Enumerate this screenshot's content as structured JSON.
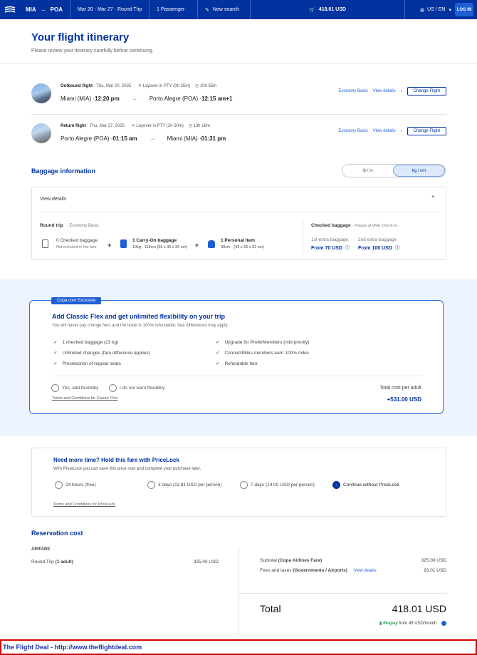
{
  "header": {
    "origin": "MIA",
    "destination": "POA",
    "dates": "Mar 20 - Mar 27 · Round Trip",
    "passengers": "1 Passenger",
    "new_search": "New search",
    "cart_total": "418.01 USD",
    "locale": "US / EN",
    "login": "LOG IN"
  },
  "page": {
    "title": "Your flight itinerary",
    "subtitle": "Please review your itinerary carefully before continuing."
  },
  "flights": [
    {
      "label": "Outbound flight",
      "date": "Thu, Mar 20, 2025",
      "layover": "Layover in PTY (0h 35m)",
      "duration": "10h 55m",
      "from": "Miami (MIA) · ",
      "from_time": "12:20 pm",
      "to": "Porto Alegre (POA) · ",
      "to_time": "12:15 am+1",
      "fare": "Economy Basic",
      "details": "View details",
      "change": "Change Flight"
    },
    {
      "label": "Return flight",
      "date": "Thu, Mar 27, 2025",
      "layover": "Layover in PTY (2h 50m)",
      "duration": "13h 16m",
      "from": "Porto Alegre (POA) · ",
      "from_time": "01:15 am",
      "to": "Miami (MIA) · ",
      "to_time": "01:31 pm",
      "fare": "Economy Basic",
      "details": "View details",
      "change": "Change Flight"
    }
  ],
  "baggage": {
    "title": "Baggage information",
    "unit_options": [
      "lb / in",
      "kg / cm"
    ],
    "unit_selected": "kg / cm",
    "view_details": "View details",
    "trip_label": "Round trip",
    "trip_fare": "· Economy Basic",
    "checked_title": "0 Checked baggage",
    "checked_sub": "Not included in the fare",
    "carry_title": "1 Carry-On baggage",
    "carry_sub": "10kg · 118cm (56 x 36 x 26 cm)",
    "personal_title": "1 Personal item",
    "personal_sub": "90cm · (43 x 25 x 22 cm)",
    "prepay_title": "Checked baggage",
    "prepay_sub": "· Prepay at Web Check-In.",
    "extra1_label": "1st extra baggage",
    "extra1_price": "From 70 USD",
    "extra2_label": "2nd extra baggage",
    "extra2_price": "From 100 USD"
  },
  "flex": {
    "badge": "Copa.com Exclusive",
    "title": "Add Classic Flex and get unlimited flexibility on your trip",
    "subtitle": "You will never pay change fees and the ticket is 100% refundable; fare differences may apply.",
    "benefits_left": [
      "1 checked baggage (23 kg)",
      "Unlimited changes (fare difference applies)",
      "Preselection of regular seats"
    ],
    "benefits_right": [
      "Upgrade for PreferMembers (mid priority)",
      "ConnectMiles members earn 100% miles",
      "Refundable fare"
    ],
    "opt_yes": "Yes, add flexibility",
    "opt_no": "I do not want flexibility",
    "terms": "Terms and Conditions for Classic Flex",
    "total_label": "Total cost per adult",
    "total_value": "+531.00 USD"
  },
  "pricelock": {
    "title": "Need more time? Hold this fare with PriceLock",
    "subtitle": "With PriceLock you can save this price now and complete your purchase later.",
    "options": [
      "24 hours (free)",
      "3 days (11.81 USD per person)",
      "7 days (14.00 USD per person)",
      "Continue without PriceLock"
    ],
    "selected": "Continue without PriceLock",
    "terms": "Terms and Conditions for PriceLock"
  },
  "reservation": {
    "title": "Reservation cost",
    "airfare_label": "AIRFARE",
    "roundtrip_label": "Round Trip",
    "roundtrip_pax": "(1 adult)",
    "roundtrip_price": "325.00 USD",
    "subtotal_label": "Subtotal",
    "subtotal_sub": "(Copa Airlines Fare)",
    "subtotal_value": "325.00 USD",
    "fees_label": "Fees and taxes",
    "fees_sub": "(Governments / Airports)",
    "fees_link": "View details",
    "fees_value": "93.01 USD",
    "total_label": "Total",
    "total_value": "418.01 USD",
    "flexpay_brand": "flexpay",
    "flexpay_text": "from 45 USD/month"
  },
  "footer": {
    "text": "The Flight Deal - http://www.theflightdeal.com"
  },
  "colors": {
    "brand": "#0032a0",
    "link": "#1e5fd6",
    "check": "#2e9b57",
    "footer_border": "#d40000"
  }
}
